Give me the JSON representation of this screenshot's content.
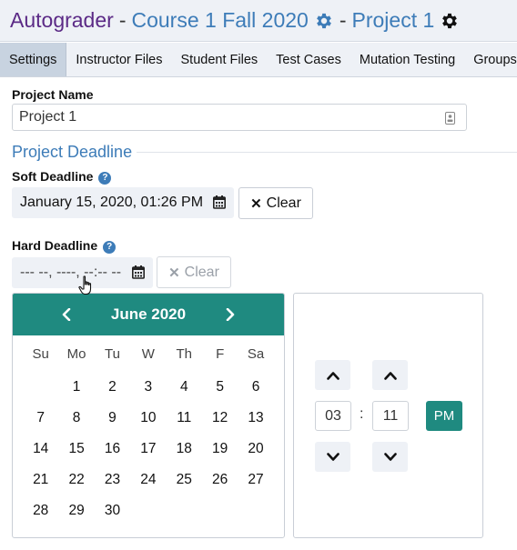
{
  "header": {
    "app_name": "Autograder",
    "separator1": "-",
    "course": "Course 1 Fall 2020",
    "separator2": "-",
    "project": "Project 1"
  },
  "tabs": [
    {
      "label": "Settings"
    },
    {
      "label": "Instructor Files"
    },
    {
      "label": "Student Files"
    },
    {
      "label": "Test Cases"
    },
    {
      "label": "Mutation Testing"
    },
    {
      "label": "Groups &"
    }
  ],
  "project_name": {
    "label": "Project Name",
    "value": "Project 1"
  },
  "deadline": {
    "section_title": "Project Deadline",
    "soft": {
      "label": "Soft Deadline",
      "value": "January 15, 2020, 01:26 PM",
      "clear_label": "Clear"
    },
    "hard": {
      "label": "Hard Deadline",
      "value": "--- --, ----, --:-- --",
      "clear_label": "Clear"
    },
    "help_glyph": "?"
  },
  "calendar": {
    "title": "June 2020",
    "weekdays": [
      "Su",
      "Mo",
      "Tu",
      "W",
      "Th",
      "F",
      "Sa"
    ],
    "weeks": [
      [
        "",
        "1",
        "2",
        "3",
        "4",
        "5",
        "6"
      ],
      [
        "7",
        "8",
        "9",
        "10",
        "11",
        "12",
        "13"
      ],
      [
        "14",
        "15",
        "16",
        "17",
        "18",
        "19",
        "20"
      ],
      [
        "21",
        "22",
        "23",
        "24",
        "25",
        "26",
        "27"
      ],
      [
        "28",
        "29",
        "30",
        "",
        "",
        "",
        ""
      ]
    ]
  },
  "time_picker": {
    "hour": "03",
    "colon": ":",
    "minute": "11",
    "ampm": "PM"
  },
  "colors": {
    "app_name": "#5b2a86",
    "link": "#3d7cb8",
    "accent": "#1f8a80"
  }
}
